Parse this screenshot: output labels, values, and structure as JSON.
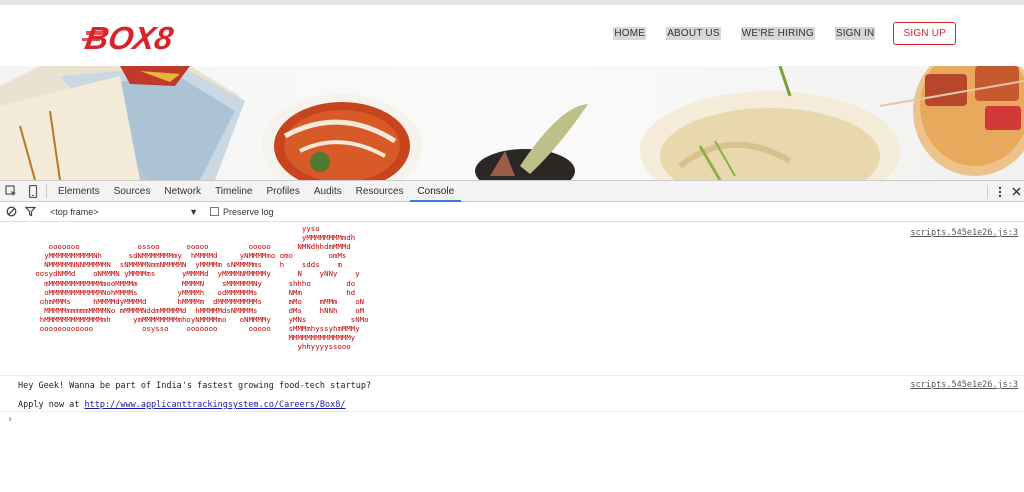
{
  "site": {
    "logo_text": "BOX8",
    "nav": {
      "home": "HOME",
      "about": "ABOUT US",
      "hiring": "WE'RE HIRING",
      "signin": "SIGN IN",
      "signup": "SIGN UP"
    },
    "brand_color": "#d8232a"
  },
  "devtools": {
    "tabs": [
      "Elements",
      "Sources",
      "Network",
      "Timeline",
      "Profiles",
      "Audits",
      "Resources",
      "Console"
    ],
    "active_tab": "Console",
    "toolbar": {
      "frame": "<top frame>",
      "preserve_log": "Preserve log"
    },
    "icons": [
      "inspect-icon",
      "device-icon",
      "clear-icon",
      "filter-icon",
      "more-icon",
      "close-icon"
    ],
    "accent_color": "#3879d9",
    "console": {
      "messages": [
        {
          "source": "scripts.545e1e26.js:3",
          "ascii_art": "                                                               yyso\n                                                               yMMMMMMMMmdh\n      ooooooo             ossoo      ooooo         ooooo      NMNdhhdmMMMd\n     yMMMMMMMMMMNh      sdNMMMMMMMmy  hMMMMd     yNMMMMmo omo        omMs\n     NMMMMMNNNMMMMMN  sNMMMMNmmNMMMMN  yMMMMm sNMMMMms    h    sdds    m\n   oosydNMMd    oNMMMN yMMMMms      yMMMMd  yMMMMNMMMMMy      N    yNNy    y\n     mMMMMMMMMMMMMmooMMMMm          MMMMN    sMMMMMMNy      shhho        do\n     oMMMMMMMMMMMMNohMMMMs         yMMMMh   odMMMMMMs       NMm          hd\n    ohmMMMs     hMMMMdyMMMMd       hMMMMm  dMMMMMMMMMs      mMo    mMMm    oN\n     MMMMMmmmmmMMMMNo mMMMMNddmMMMMMd  hMMMMMdsNMMMMs       dMs    hNNh    oM\n    hMMMMMMMMMMMMMmh     ymMMMMMMMMmhoyNMMMMmo   oNMMMMy    yMNs          sNMo\n    oooooooooooo           osysso    ooooooo       ooooo    sMMMmhyssyhmMMMy\n                                                            MMMMMMMMMMMMMMy\n                                                              yhhyyyyssooo"
        },
        {
          "source": "scripts.545e1e26.js:3",
          "line1": "Hey Geek! Wanna be part of India's fastest growing food-tech startup?",
          "line2_prefix": "Apply now at ",
          "line2_url": "http://www.applicanttrackingsystem.co/Careers/Box8/"
        }
      ],
      "prompt": "›"
    }
  }
}
